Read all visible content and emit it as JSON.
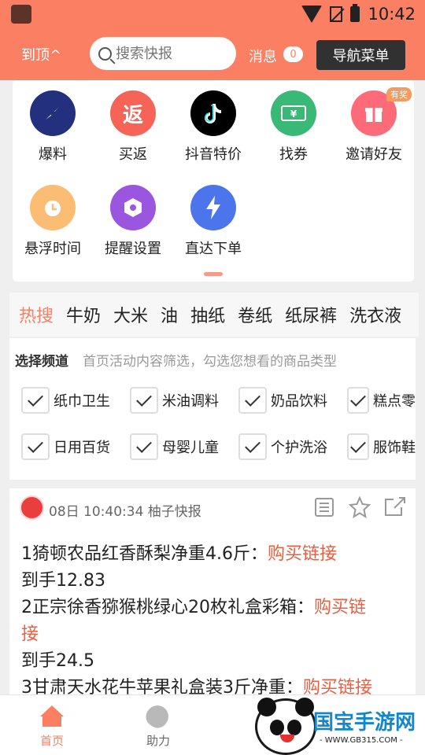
{
  "status": {
    "time": "10:42"
  },
  "header": {
    "back_to_top": "到顶^",
    "search_placeholder": "搜索快报",
    "message_label": "消息",
    "message_count": "0",
    "nav_menu": "导航菜单"
  },
  "grid": {
    "items": [
      {
        "label": "爆料",
        "icon": "compass-icon",
        "color": "#23307d"
      },
      {
        "label": "买返",
        "icon": "fan",
        "color": "#f56457"
      },
      {
        "label": "抖音特价",
        "icon": "tiktok-icon",
        "color": "#000000"
      },
      {
        "label": "找券",
        "icon": "coupon-icon",
        "color": "#3ab875"
      },
      {
        "label": "邀请好友",
        "icon": "gift-icon",
        "color": "#fd6b79"
      },
      {
        "label": "悬浮时间",
        "icon": "alarm-clock-icon",
        "color": "#fbbd73"
      },
      {
        "label": "提醒设置",
        "icon": "settings-icon",
        "color": "#9a56de"
      },
      {
        "label": "直达下单",
        "icon": "lightning-icon",
        "color": "#4c75eb"
      }
    ],
    "reward_badge": "有奖"
  },
  "tags": [
    "热搜",
    "牛奶",
    "大米",
    "油",
    "抽纸",
    "卷纸",
    "纸尿裤",
    "洗衣液"
  ],
  "channels": {
    "title": "选择频道",
    "description": "首页活动内容筛选，勾选您想看的商品类型",
    "items": [
      "纸巾卫生",
      "米油调料",
      "奶品饮料",
      "糕点零",
      "日用百货",
      "母婴儿童",
      "个护洗浴",
      "服饰鞋"
    ]
  },
  "news": {
    "meta": "08日 10:40:34 柚子快报",
    "lines": [
      {
        "text": "1猗顿农品红香酥梨净重4.6斤：",
        "link": "购买链接"
      },
      {
        "text": "到手12.83",
        "link": ""
      },
      {
        "text": "2正宗徐香猕猴桃绿心20枚礼盒彩箱：",
        "link": "购买链"
      },
      {
        "text": "",
        "link": "接"
      },
      {
        "text": "到手24.5",
        "link": ""
      },
      {
        "text": "3甘肃天水花牛苹果礼盒装3斤净重：",
        "link": "购买链接"
      }
    ]
  },
  "bottom_nav": {
    "home": "首页",
    "assist": "助力"
  },
  "watermark": {
    "title": "国宝手游网",
    "url": "- WWW.GB315.COM -"
  }
}
